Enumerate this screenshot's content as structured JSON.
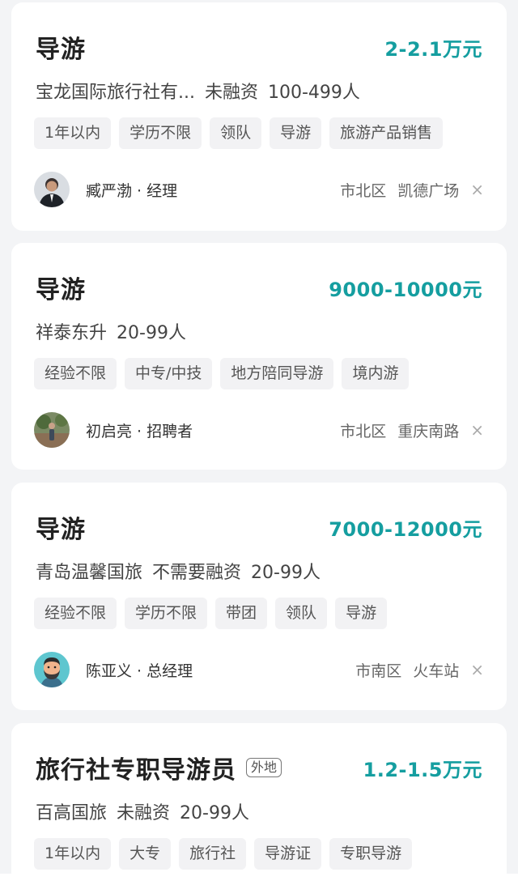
{
  "jobs": [
    {
      "title": "导游",
      "salary": "2-2.1万元",
      "company": [
        "宝龙国际旅行社有...",
        "未融资",
        "100-499人"
      ],
      "tags": [
        "1年以内",
        "学历不限",
        "领队",
        "导游",
        "旅游产品销售"
      ],
      "recruiter": "臧严渤 · 经理",
      "district": "市北区",
      "area": "凯德广场",
      "avatar": "avatar-man-suit"
    },
    {
      "title": "导游",
      "salary": "9000-10000元",
      "company": [
        "祥泰东升",
        "20-99人"
      ],
      "tags": [
        "经验不限",
        "中专/中技",
        "地方陪同导游",
        "境内游"
      ],
      "recruiter": "初启亮 · 招聘者",
      "district": "市北区",
      "area": "重庆南路",
      "avatar": "avatar-outdoor"
    },
    {
      "title": "导游",
      "salary": "7000-12000元",
      "company": [
        "青岛温馨国旅",
        "不需要融资",
        "20-99人"
      ],
      "tags": [
        "经验不限",
        "学历不限",
        "带团",
        "领队",
        "导游"
      ],
      "recruiter": "陈亚义 · 总经理",
      "district": "市南区",
      "area": "火车站",
      "avatar": "avatar-cartoon-beard"
    },
    {
      "title": "旅行社专职导游员",
      "badge": "外地",
      "salary": "1.2-1.5万元",
      "company": [
        "百高国旅",
        "未融资",
        "20-99人"
      ],
      "tags": [
        "1年以内",
        "大专",
        "旅行社",
        "导游证",
        "专职导游"
      ]
    }
  ],
  "close_icon": "×",
  "colors": {
    "salary": "#159ea0",
    "background": "#f3f4f6",
    "card": "#ffffff"
  }
}
